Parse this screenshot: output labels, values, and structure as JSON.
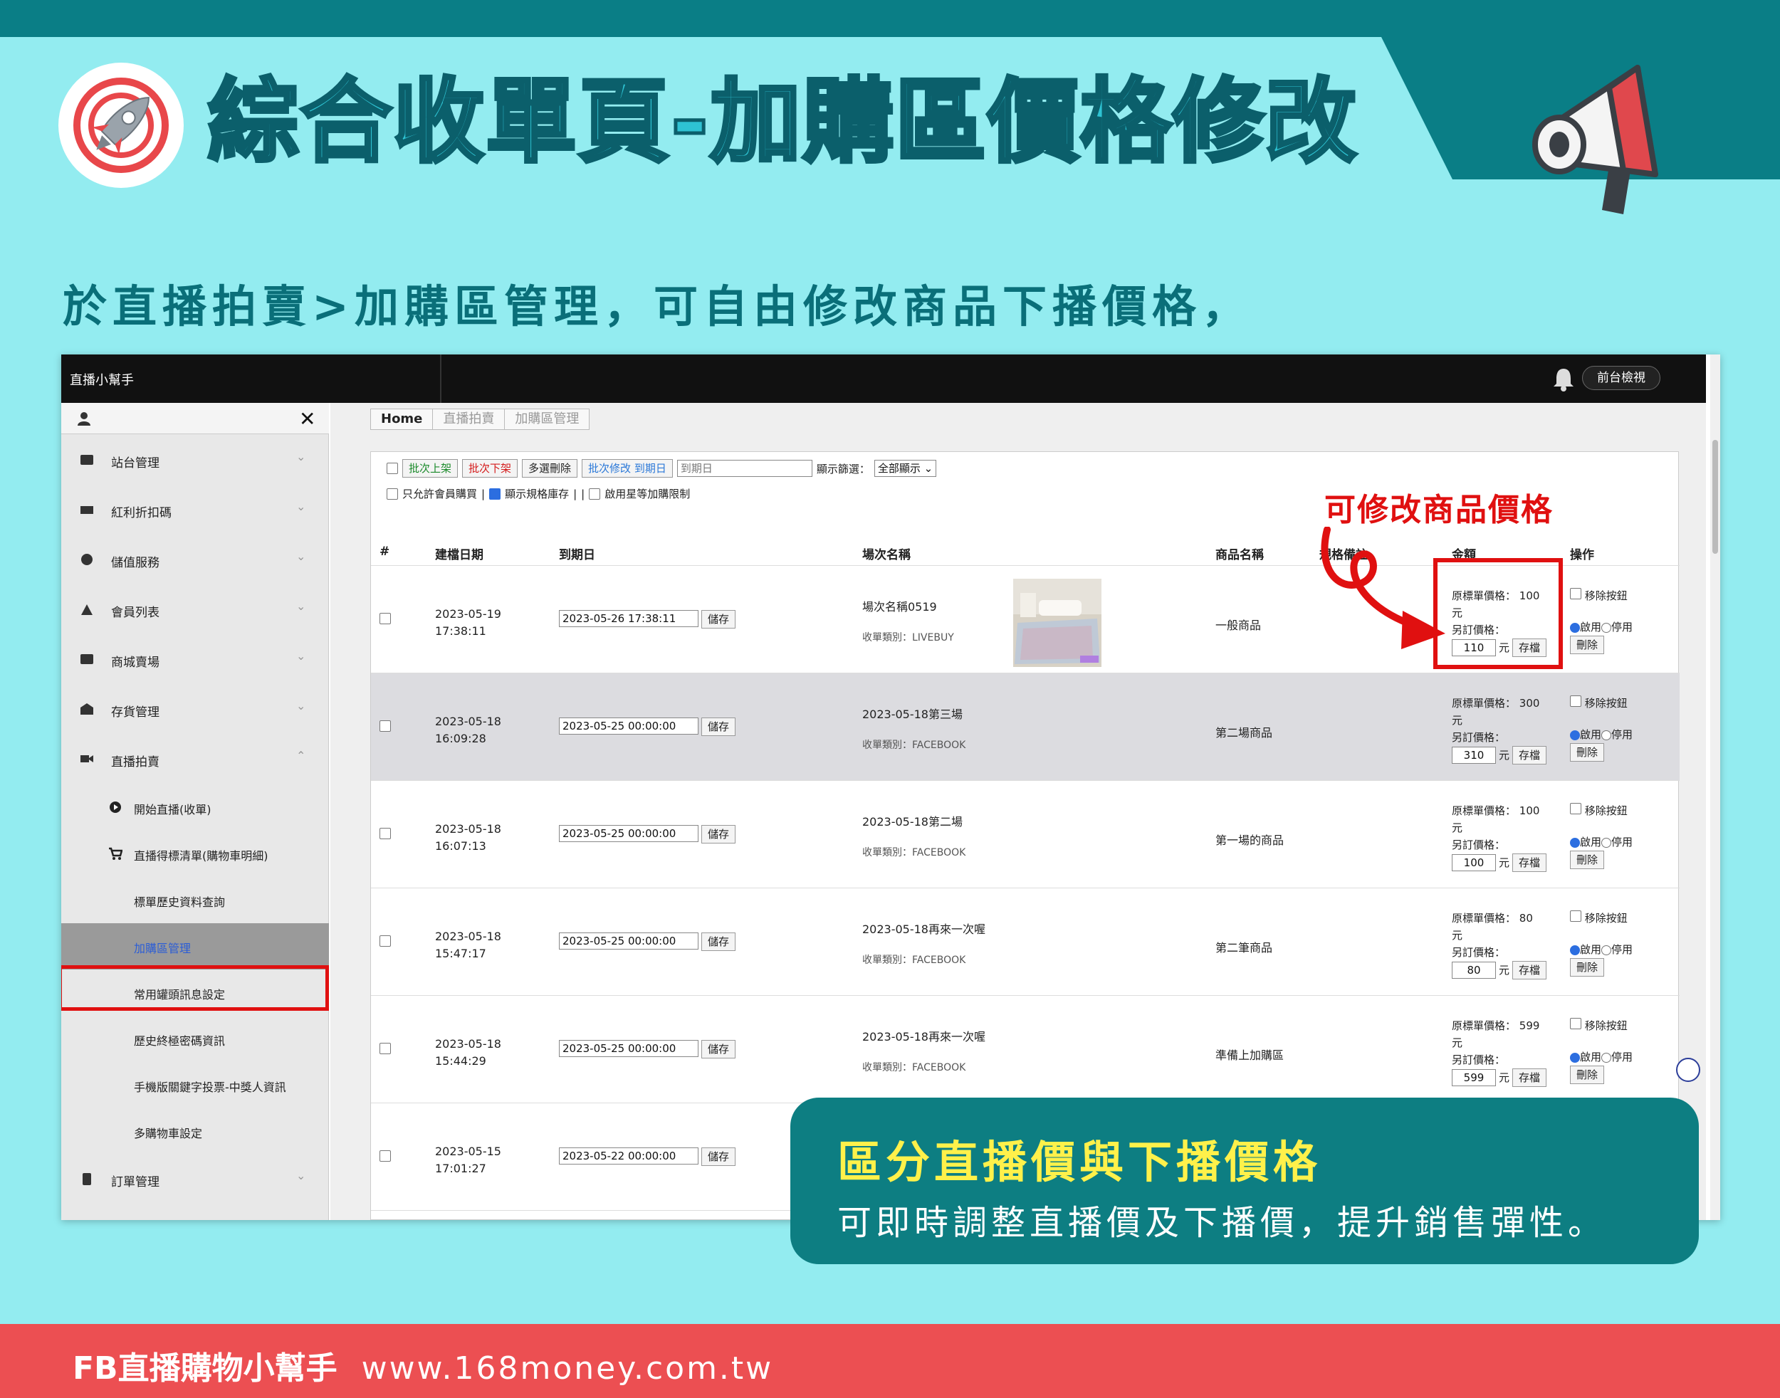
{
  "poster": {
    "title": "綜合收單頁-加購區價格修改",
    "subtitle": "於直播拍賣>加購區管理，可自由修改商品下播價格，",
    "annotation": "可修改商品價格",
    "callout_heading": "區分直播價與下播價格",
    "callout_text": "可即時調整直播價及下播價，提升銷售彈性。",
    "footer_brand": "FB直播購物小幫手",
    "footer_url": "www.168money.com.tw",
    "colors": {
      "background": "#93ecf0",
      "teal": "#0a7e86",
      "title": "#2ec3d3",
      "highlight": "#e01010",
      "footer": "#ec4f52",
      "callout_heading": "#fff14a"
    }
  },
  "app": {
    "brand": "直播小幫手",
    "front_view": "前台檢視",
    "icons": {
      "bell": "bell-icon",
      "user": "user-icon",
      "close": "close-icon"
    }
  },
  "sidebar": {
    "items": [
      {
        "label": "站台管理",
        "icon": "store-icon"
      },
      {
        "label": "紅利折扣碼",
        "icon": "ticket-icon"
      },
      {
        "label": "儲值服務",
        "icon": "coin-icon"
      },
      {
        "label": "會員列表",
        "icon": "members-icon"
      },
      {
        "label": "商城賣場",
        "icon": "shop-icon"
      },
      {
        "label": "存貨管理",
        "icon": "warehouse-icon"
      },
      {
        "label": "直播拍賣",
        "icon": "video-icon"
      }
    ],
    "sub_items": [
      {
        "label": "開始直播(收單)",
        "icon": "play-icon"
      },
      {
        "label": "直播得標清單(購物車明細)",
        "icon": "cart-icon"
      },
      {
        "label": "標單歷史資料查詢"
      },
      {
        "label": "加購區管理",
        "active": true
      },
      {
        "label": "常用罐頭訊息設定"
      },
      {
        "label": "歷史終極密碼資訊"
      },
      {
        "label": "手機版關鍵字投票-中獎人資訊"
      },
      {
        "label": "多購物車設定"
      }
    ],
    "last_item": {
      "label": "訂單管理",
      "icon": "clipboard-icon"
    }
  },
  "breadcrumb": [
    "Home",
    "直播拍賣",
    "加購區管理"
  ],
  "toolbar": {
    "batch_on": "批次上架",
    "batch_off": "批次下架",
    "multi_delete": "多選刪除",
    "batch_expire": "批次修改 到期日",
    "expire_placeholder": "到期日",
    "filter_label": "顯示篩選：",
    "filter_value": "全部顯示",
    "member_only": "只允許會員購買",
    "sep1": "|",
    "show_stock": "顯示規格庫存",
    "sep2": "|",
    "sep3": "|",
    "star_limit": "啟用星等加購限制"
  },
  "table": {
    "headers": {
      "num": "#",
      "created": "建檔日期",
      "expire": "到期日",
      "show": "場次名稱",
      "product": "商品名稱",
      "spec": "規格備註",
      "amount": "金額",
      "ops": "操作"
    },
    "labels": {
      "save": "儲存",
      "orig_price": "原標單價格：",
      "yuan": "元",
      "new_price": "另訂價格：",
      "archive": "存檔",
      "remove_button": "移除按鈕",
      "enable": "啟用",
      "disable": "停用",
      "delete": "刪除"
    },
    "rows": [
      {
        "created_date": "2023-05-19",
        "created_time": "17:38:11",
        "expire": "2023-05-26 17:38:11",
        "show": "場次名稱0519",
        "category": "收單類別：LIVEBUY",
        "product": "一般商品",
        "orig": "100",
        "new": "110",
        "has_image": true
      },
      {
        "created_date": "2023-05-18",
        "created_time": "16:09:28",
        "expire": "2023-05-25 00:00:00",
        "show": "2023-05-18第三場",
        "category": "收單類別：FACEBOOK",
        "product": "第二場商品",
        "orig": "300",
        "new": "310"
      },
      {
        "created_date": "2023-05-18",
        "created_time": "16:07:13",
        "expire": "2023-05-25 00:00:00",
        "show": "2023-05-18第二場",
        "category": "收單類別：FACEBOOK",
        "product": "第一場的商品",
        "orig": "100",
        "new": "100"
      },
      {
        "created_date": "2023-05-18",
        "created_time": "15:47:17",
        "expire": "2023-05-25 00:00:00",
        "show": "2023-05-18再來一次喔",
        "category": "收單類別：FACEBOOK",
        "product": "第二筆商品",
        "orig": "80",
        "new": "80"
      },
      {
        "created_date": "2023-05-18",
        "created_time": "15:44:29",
        "expire": "2023-05-25 00:00:00",
        "show": "2023-05-18再來一次喔",
        "category": "收單類別：FACEBOOK",
        "product": "準備上加購區",
        "orig": "599",
        "new": "599"
      },
      {
        "created_date": "2023-05-15",
        "created_time": "17:01:27",
        "expire": "2023-05-22 00:00:00"
      }
    ]
  }
}
